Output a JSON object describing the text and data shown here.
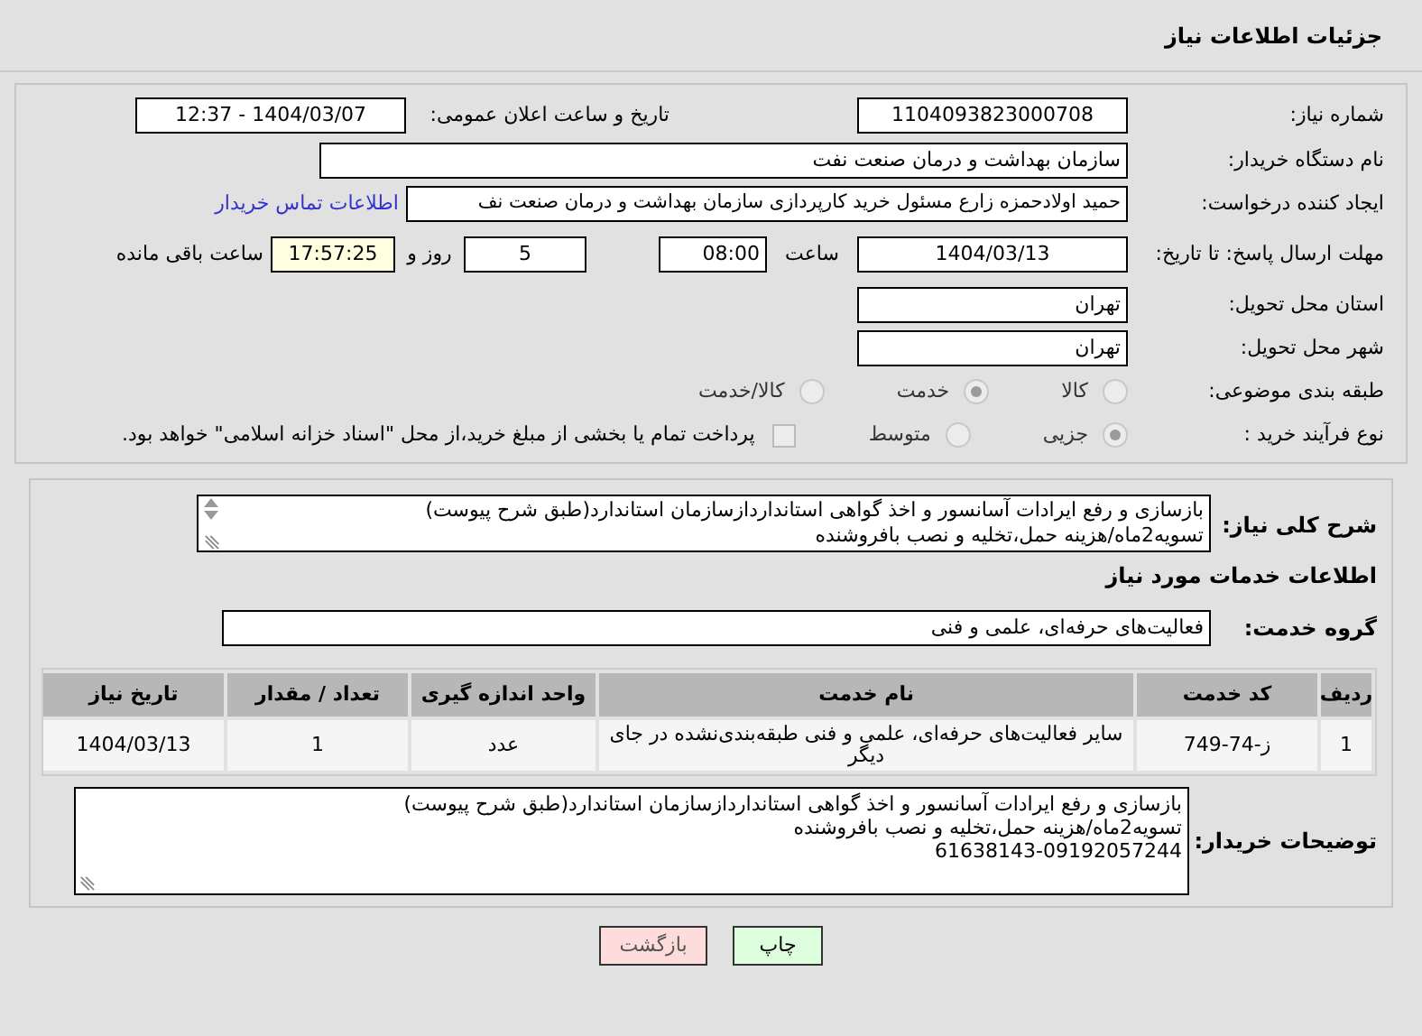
{
  "header": {
    "title": "جزئیات اطلاعات نیاز"
  },
  "need_number": {
    "label": "شماره نیاز:",
    "value": "1104093823000708"
  },
  "announce": {
    "label": "تاریخ و ساعت اعلان عمومی:",
    "value": "1404/03/07 - 12:37"
  },
  "buyer_org": {
    "label": "نام دستگاه خریدار:",
    "value": "سازمان بهداشت و درمان صنعت نفت"
  },
  "creator": {
    "label": "ایجاد کننده درخواست:",
    "value": "حمید اولادحمزه زارع مسئول خرید کارپردازی سازمان بهداشت و درمان صنعت نف",
    "link": "اطلاعات تماس خریدار"
  },
  "deadline": {
    "label": "مهلت ارسال پاسخ: تا تاریخ:",
    "date": "1404/03/13",
    "time_label": "ساعت",
    "time": "08:00",
    "days": "5",
    "days_label": "روز و",
    "remaining": "17:57:25",
    "remaining_label": "ساعت باقی مانده"
  },
  "province": {
    "label": "استان محل تحویل:",
    "value": "تهران"
  },
  "city": {
    "label": "شهر محل تحویل:",
    "value": "تهران"
  },
  "category": {
    "label": "طبقه بندی موضوعی:",
    "options": [
      {
        "label": "کالا",
        "selected": false
      },
      {
        "label": "خدمت",
        "selected": true
      },
      {
        "label": "کالا/خدمت",
        "selected": false
      }
    ]
  },
  "process": {
    "label": "نوع فرآیند خرید :",
    "options": [
      {
        "label": "جزیی",
        "selected": true
      },
      {
        "label": "متوسط",
        "selected": false
      }
    ],
    "payment": {
      "checked": false,
      "text": "پرداخت تمام یا بخشی از مبلغ خرید،از محل \"اسناد خزانه اسلامی\" خواهد بود."
    }
  },
  "description": {
    "label": "شرح کلی نیاز:",
    "lines": [
      "بازسازی و رفع ایرادات آسانسور و اخذ گواهی استانداردازسازمان استاندارد(طبق شرح پیوست)",
      "تسویه2ماه/هزینه حمل،تخلیه و نصب بافروشنده"
    ]
  },
  "services_heading": "اطلاعات خدمات مورد نیاز",
  "service_group": {
    "label": "گروه خدمت:",
    "value": "فعالیت‌های حرفه‌ای، علمی و فنی"
  },
  "table": {
    "columns": [
      "ردیف",
      "کد خدمت",
      "نام خدمت",
      "واحد اندازه گیری",
      "تعداد / مقدار",
      "تاریخ نیاز"
    ],
    "rows": [
      [
        "1",
        "ز-74-749",
        "سایر فعالیت‌های حرفه‌ای، علمی و فنی طبقه‌بندی‌نشده در جای دیگر",
        "عدد",
        "1",
        "1404/03/13"
      ]
    ]
  },
  "buyer_notes": {
    "label": "توضیحات خریدار:",
    "lines": [
      "بازسازی و رفع ایرادات آسانسور و اخذ گواهی استانداردازسازمان استاندارد(طبق شرح پیوست)",
      "تسویه2ماه/هزینه حمل،تخلیه و نصب بافروشنده",
      "61638143-09192057244"
    ]
  },
  "buttons": [
    {
      "label": "چاپ",
      "kind": "print"
    },
    {
      "label": "بازگشت",
      "kind": "back"
    }
  ]
}
